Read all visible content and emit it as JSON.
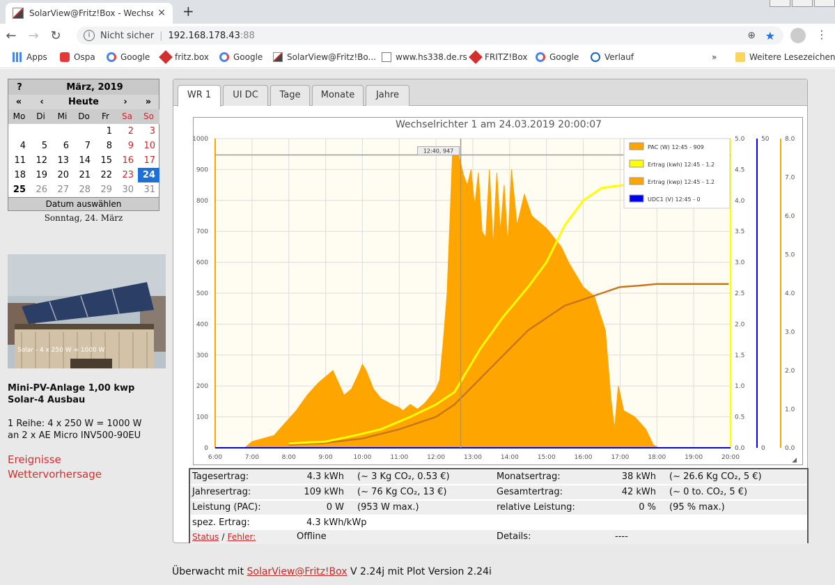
{
  "browser": {
    "tab_title": "SolarView@Fritz!Box - Wechselrichter",
    "security": "Nicht sicher",
    "url": "192.168.178.43",
    "port": ":88"
  },
  "bookmarks": [
    "Apps",
    "Ospa",
    "Google",
    "fritz.box",
    "Google",
    "SolarView@Fritz!Bo...",
    "www.hs338.de.rs",
    "FRITZ!Box",
    "Google",
    "Verlauf",
    "Weitere Lesezeichen"
  ],
  "calendar": {
    "help": "?",
    "month": "März, 2019",
    "nav": [
      "«",
      "‹",
      "Heute",
      "›",
      "»"
    ],
    "weekdays": [
      "Mo",
      "Di",
      "Mi",
      "Do",
      "Fr",
      "Sa",
      "So"
    ],
    "days": [
      "",
      "",
      "",
      "",
      "1",
      "2",
      "3",
      "4",
      "5",
      "6",
      "7",
      "8",
      "9",
      "10",
      "11",
      "12",
      "13",
      "14",
      "15",
      "16",
      "17",
      "18",
      "19",
      "20",
      "21",
      "22",
      "23",
      "24",
      "25",
      "26",
      "27",
      "28",
      "29",
      "30",
      "31"
    ],
    "footer": "Datum auswählen",
    "date_label": "Sonntag, 24. März"
  },
  "photo_caption": "Solar - 4 x 250 W = 1000 W",
  "description": {
    "title1": "Mini-PV-Anlage 1,00 kwp",
    "title2": "Solar-4 Ausbau",
    "line1": "1 Reihe: 4 x 250 W = 1000 W",
    "line2": "an 2 x AE Micro INV500-90EU"
  },
  "links": [
    "Ereignisse",
    "Wettervorhersage"
  ],
  "tabs": [
    "WR 1",
    "UI DC",
    "Tage",
    "Monate",
    "Jahre"
  ],
  "chart_data": {
    "type": "area",
    "title": "Wechselrichter 1 am 24.03.2019 20:00:07",
    "cursor_label": "12:40, 947",
    "x_ticks": [
      "6:00",
      "7:00",
      "8:00",
      "9:00",
      "10:00",
      "11:00",
      "12:00",
      "13:00",
      "14:00",
      "15:00",
      "16:00",
      "17:00",
      "18:00",
      "19:00",
      "20:00"
    ],
    "y_left_ticks": [
      "0",
      "100",
      "200",
      "300",
      "400",
      "500",
      "600",
      "700",
      "800",
      "900",
      "1000"
    ],
    "y_left_lim": [
      0,
      1000
    ],
    "y_right1_ticks": [
      "0.0",
      "0.5",
      "1.0",
      "1.5",
      "2.0",
      "2.5",
      "3.0",
      "3.5",
      "4.0",
      "4.5",
      "5.0"
    ],
    "y_right1_lim": [
      0,
      5
    ],
    "y_right2_ticks": [
      "0",
      "50"
    ],
    "y_right2_lim": [
      0,
      50
    ],
    "y_right3_ticks": [
      "0.0",
      "1.0",
      "2.0",
      "3.0",
      "4.0",
      "5.0",
      "6.0",
      "7.0",
      "8.0"
    ],
    "y_right3_lim": [
      0,
      8
    ],
    "legend": [
      {
        "label": "PAC (W) 12:45 - 909",
        "color": "#ffa500"
      },
      {
        "label": "Ertrag (kwh) 12:45 - 1.2",
        "color": "#ffff00"
      },
      {
        "label": "Ertrag (kwp) 12:45 - 1.2",
        "color": "#ffa500"
      },
      {
        "label": "UDC1 (V) 12:45 - 0",
        "color": "#0000ee"
      }
    ],
    "series": [
      {
        "name": "PAC (W)",
        "x": [
          6.8,
          7.0,
          7.3,
          7.6,
          7.9,
          8.2,
          8.5,
          8.8,
          9.0,
          9.2,
          9.35,
          9.5,
          9.7,
          9.9,
          10.0,
          10.1,
          10.3,
          10.5,
          10.8,
          11.0,
          11.1,
          11.3,
          11.5,
          11.7,
          11.9,
          12.0,
          12.1,
          12.2,
          12.3,
          12.45,
          12.55,
          12.6,
          12.67,
          12.75,
          12.85,
          12.95,
          13.05,
          13.15,
          13.25,
          13.35,
          13.45,
          13.55,
          13.65,
          13.75,
          13.85,
          13.95,
          14.05,
          14.2,
          14.4,
          14.6,
          14.8,
          15.0,
          15.2,
          15.4,
          15.6,
          15.8,
          16.0,
          16.3,
          16.6,
          16.75,
          16.85,
          16.95,
          17.1,
          17.4,
          17.7,
          17.9,
          18.05
        ],
        "values": [
          0,
          20,
          30,
          40,
          80,
          120,
          170,
          210,
          230,
          250,
          210,
          170,
          190,
          240,
          270,
          250,
          190,
          160,
          140,
          130,
          120,
          140,
          125,
          145,
          175,
          190,
          220,
          350,
          500,
          960,
          950,
          955,
          920,
          880,
          850,
          900,
          780,
          890,
          700,
          680,
          900,
          650,
          890,
          700,
          850,
          660,
          900,
          720,
          820,
          750,
          730,
          710,
          680,
          650,
          600,
          560,
          520,
          490,
          380,
          160,
          60,
          200,
          120,
          100,
          60,
          10,
          0
        ]
      },
      {
        "name": "Ertrag (kwh)",
        "x": [
          8.0,
          9.0,
          9.8,
          10.5,
          11.3,
          12.0,
          12.5,
          12.8,
          13.2,
          13.8,
          14.5,
          15.0,
          15.5,
          16.0,
          16.5,
          17.0,
          17.5,
          18.0,
          19.0,
          19.95
        ],
        "values": [
          0.07,
          0.1,
          0.2,
          0.3,
          0.5,
          0.7,
          0.9,
          1.2,
          1.6,
          2.1,
          2.6,
          3.0,
          3.6,
          4.0,
          4.2,
          4.24,
          4.28,
          4.3,
          4.3,
          4.3
        ]
      },
      {
        "name": "Ertrag (kwp)",
        "x": [
          8.0,
          9.0,
          10.0,
          11.0,
          12.0,
          12.5,
          13.0,
          13.5,
          14.0,
          14.5,
          15.0,
          15.5,
          16.0,
          16.5,
          17.0,
          17.5,
          18.0,
          19.0,
          19.95
        ],
        "values": [
          0.05,
          0.08,
          0.15,
          0.3,
          0.5,
          0.7,
          1.0,
          1.3,
          1.6,
          1.9,
          2.1,
          2.3,
          2.4,
          2.5,
          2.6,
          2.62,
          2.65,
          2.65,
          2.65
        ]
      },
      {
        "name": "UDC1 (V)",
        "x": [
          6.0,
          20.0
        ],
        "values": [
          0,
          0
        ]
      }
    ]
  },
  "table": {
    "r1": {
      "l1": "Tagesertrag:",
      "v1": "4.3 kWh",
      "n1": "(~ 3 Kg CO₂, 0.53 €)",
      "l2": "Monatsertrag:",
      "v2": "38 kWh",
      "n2": "(~ 26.6 Kg CO₂, 5 €)"
    },
    "r2": {
      "l1": "Jahresertrag:",
      "v1": "109 kWh",
      "n1": "(~ 76 Kg CO₂, 13 €)",
      "l2": "Gesamtertrag:",
      "v2": "42 kWh",
      "n2": "(~ 0 to. CO₂, 5 €)"
    },
    "r3": {
      "l1": "Leistung (PAC):",
      "v1": "0 W",
      "n1": "(953 W max.)",
      "l2": "relative Leistung:",
      "v2": "0 %",
      "n2": "(95 % max.)"
    },
    "r4": {
      "l1": "spez. Ertrag:",
      "v1": "4.3 kWh/kWp"
    },
    "r5": {
      "status": "Status",
      "sep": "/",
      "fehler": "Fehler:",
      "v1": "Offline",
      "l2": "Details:",
      "v2": "----"
    }
  },
  "footer": {
    "pre": "Überwacht mit ",
    "link": "SolarView@Fritz!Box",
    "post": " V 2.24j mit Plot Version 2.24i"
  }
}
